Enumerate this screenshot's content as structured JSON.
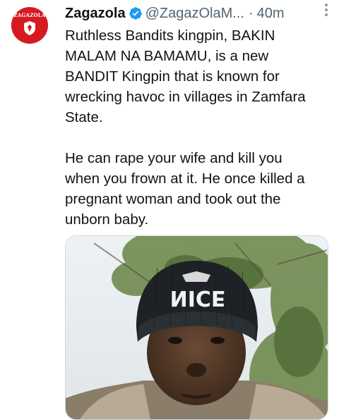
{
  "tweet": {
    "display_name": "Zagazola",
    "handle": "@ZagazOlaM...",
    "separator": "·",
    "timestamp": "40m",
    "avatar_label": "ZAGAZOLA",
    "paragraphs": [
      "Ruthless Bandits kingpin, BAKIN\nMALAM  NA  BAMAMU, is a new\nBANDIT Kingpin that is known for\nwrecking havoc in villages in Zamfara\nState.",
      "He can rape your wife and kill you\nwhen you frown at it. He once killed a\npregnant woman  and  took out the\nunborn baby."
    ],
    "media": {
      "beanie_text": "NICE"
    }
  },
  "icons": {
    "verified": "verified-badge-icon",
    "more": "more-options-icon"
  },
  "colors": {
    "verified": "#1d9bf0",
    "avatar_bg": "#d71920",
    "secondary_text": "#536471"
  }
}
